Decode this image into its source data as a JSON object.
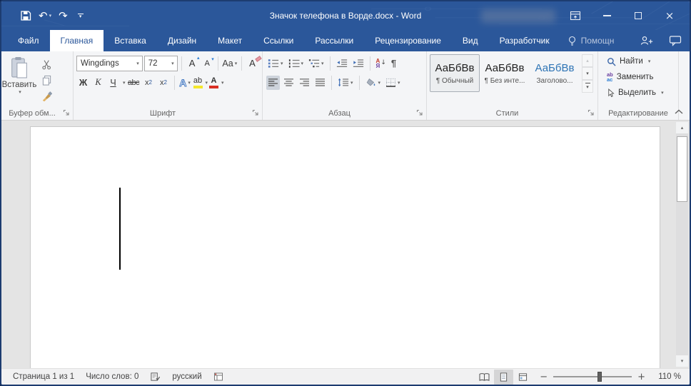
{
  "window": {
    "title": "Значок телефона в Ворде.docx - Word"
  },
  "icons": {
    "undo": "↶",
    "redo": "↷",
    "dropdown": "▾",
    "close": "×",
    "up_arrow": "▴",
    "down_arrow": "▾",
    "pilcrow": "¶",
    "zoom_out": "−",
    "zoom_in": "+",
    "sort_down": "↓"
  },
  "tabs": [
    {
      "label": "Файл",
      "active": false
    },
    {
      "label": "Главная",
      "active": true
    },
    {
      "label": "Вставка",
      "active": false
    },
    {
      "label": "Дизайн",
      "active": false
    },
    {
      "label": "Макет",
      "active": false
    },
    {
      "label": "Ссылки",
      "active": false
    },
    {
      "label": "Рассылки",
      "active": false
    },
    {
      "label": "Рецензирование",
      "active": false
    },
    {
      "label": "Вид",
      "active": false
    },
    {
      "label": "Разработчик",
      "active": false
    }
  ],
  "assistant": {
    "label": "Помощн"
  },
  "ribbon": {
    "clipboard": {
      "paste_label": "Вставить",
      "group_label": "Буфер обм..."
    },
    "font": {
      "name": "Wingdings",
      "size": "72",
      "group_label": "Шрифт",
      "bold": "Ж",
      "italic": "К",
      "underline": "Ч",
      "strikethrough": "abc",
      "sub_base": "x",
      "sub_idx": "2",
      "sup_base": "x",
      "sup_idx": "2",
      "grow": "А",
      "shrink": "А",
      "change_case": "Аа",
      "clear": "А",
      "effects": "А",
      "highlight": "ab",
      "color_letter": "А"
    },
    "paragraph": {
      "group_label": "Абзац",
      "sort_top": "А",
      "sort_bottom": "Я"
    },
    "styles": {
      "group_label": "Стили",
      "items": [
        {
          "preview": "АаБбВв",
          "label": "¶ Обычный",
          "selected": true
        },
        {
          "preview": "АаБбВв",
          "label": "¶ Без инте...",
          "selected": false
        },
        {
          "preview": "АаБбВв",
          "label": "Заголово...",
          "selected": false
        }
      ]
    },
    "editing": {
      "find_label": "Найти",
      "replace_label": "Заменить",
      "select_label": "Выделить",
      "replace_glyph_top": "ab",
      "replace_glyph_bottom": "ac",
      "group_label": "Редактирование"
    }
  },
  "status": {
    "page_indicator": "Страница 1 из 1",
    "word_count": "Число слов: 0",
    "language": "русский",
    "zoom_level": "110 %"
  },
  "colors": {
    "titlebar": "#2b579a",
    "active_tab_text": "#2b579a",
    "highlight_yellow": "#f3e72c",
    "font_color_red": "#d93025",
    "heading_blue": "#2e74b5"
  }
}
